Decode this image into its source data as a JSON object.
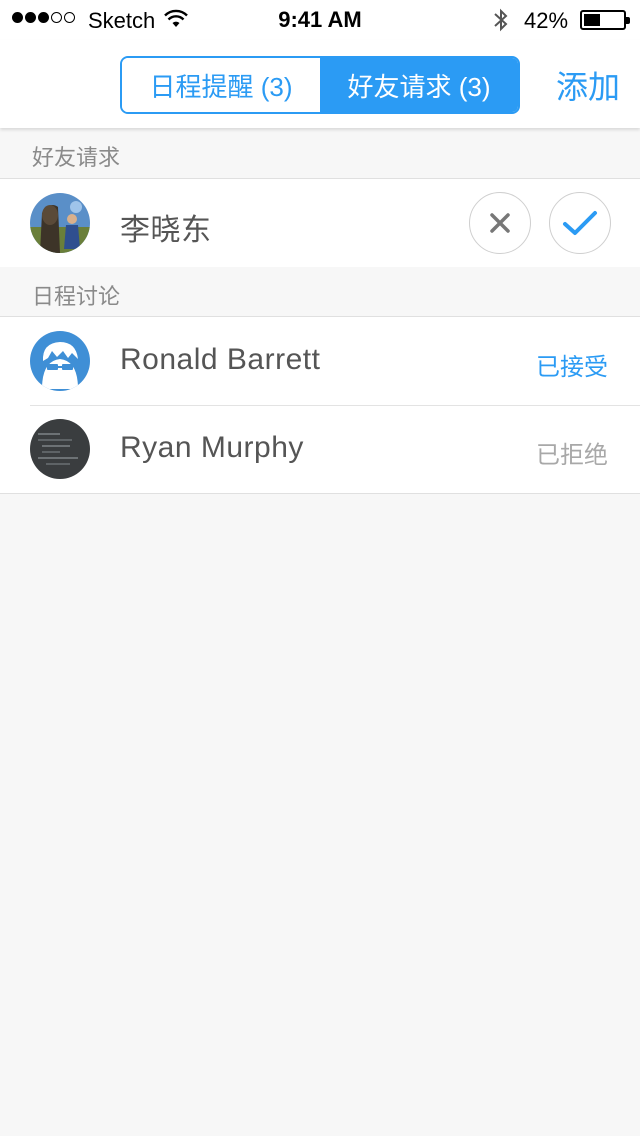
{
  "status_bar": {
    "carrier": "Sketch",
    "time": "9:41 AM",
    "battery_text": "42%",
    "battery_level": 0.42
  },
  "nav": {
    "tabs": [
      {
        "label": "日程提醒 (3)",
        "active": false
      },
      {
        "label": "好友请求 (3)",
        "active": true
      }
    ],
    "add_label": "添加"
  },
  "friend_requests": {
    "header": "好友请求",
    "items": [
      {
        "name": "李晓东",
        "avatar": "photo-avatar-icon"
      }
    ]
  },
  "schedule_discussions": {
    "header": "日程讨论",
    "items": [
      {
        "name": "Ronald Barrett",
        "status": "已接受",
        "status_type": "accepted",
        "avatar": "cartoon-glasses-avatar-icon"
      },
      {
        "name": "Ryan Murphy",
        "status": "已拒绝",
        "status_type": "declined",
        "avatar": "code-screen-avatar-icon"
      }
    ]
  },
  "colors": {
    "accent": "#2b9bf4",
    "background": "#f7f7f7",
    "declined": "#a8a8a8",
    "reject_icon": "#777777"
  }
}
